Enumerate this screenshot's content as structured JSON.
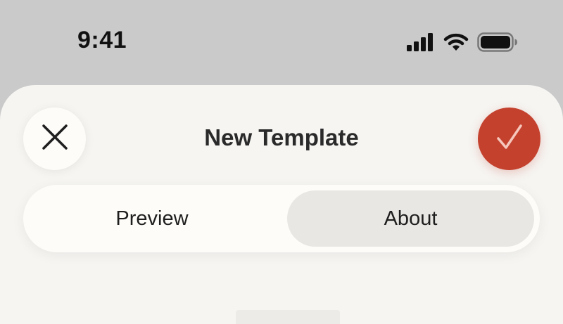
{
  "status_bar": {
    "time": "9:41",
    "icons": [
      "cellular-signal-icon",
      "wifi-icon",
      "battery-icon"
    ]
  },
  "sheet": {
    "title": "New Template",
    "close_icon": "close-icon",
    "confirm_icon": "checkmark-icon",
    "segments": [
      {
        "label": "Preview",
        "selected": false
      },
      {
        "label": "About",
        "selected": true
      }
    ]
  },
  "colors": {
    "background": "#cacaca",
    "sheet": "#f6f5f2",
    "accent": "#c4412e",
    "segment_selected": "#e9e7e3"
  }
}
